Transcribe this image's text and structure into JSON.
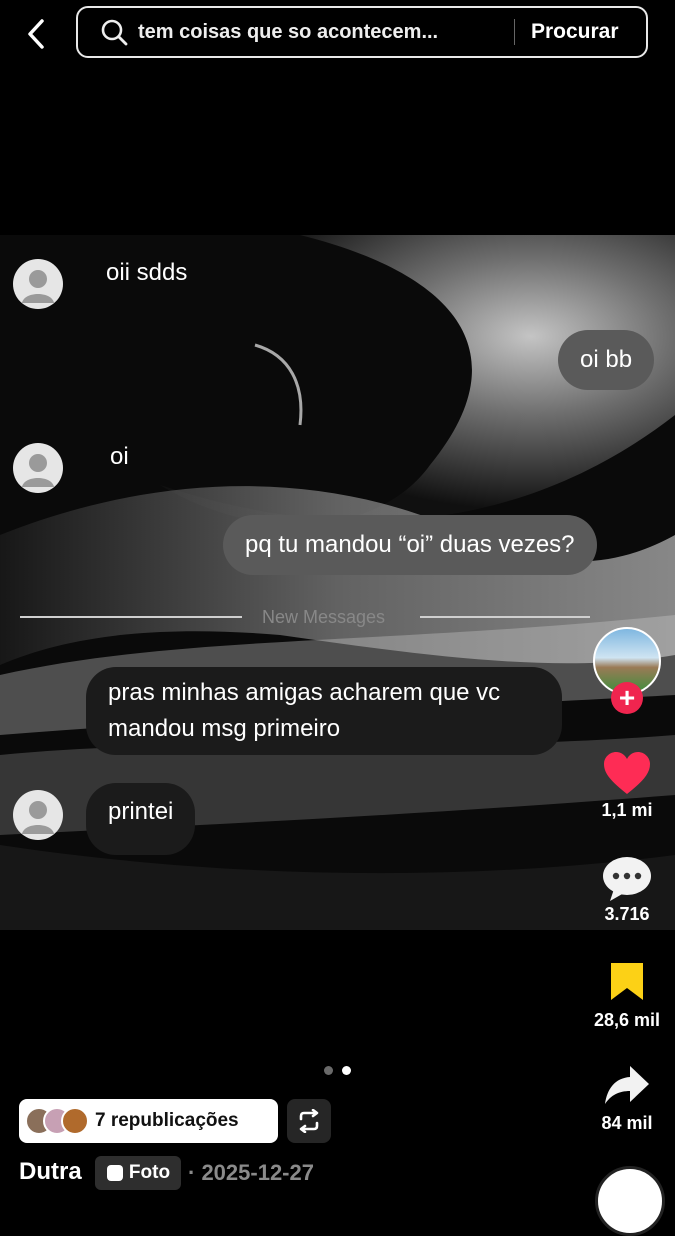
{
  "search": {
    "query": "tem coisas que so acontecem...",
    "button_label": "Procurar"
  },
  "chat": {
    "messages": [
      {
        "side": "in",
        "text": "oii sdds"
      },
      {
        "side": "out",
        "text": "oi bb"
      },
      {
        "side": "in",
        "text": "oi"
      },
      {
        "side": "out",
        "text": "pq tu mandou “oi” duas vezes?"
      },
      {
        "side": "in",
        "text": "pras minhas amigas acharem que vc mandou msg primeiro"
      },
      {
        "side": "in",
        "text": "printei"
      }
    ],
    "divider_label": "New Messages"
  },
  "rail": {
    "likes": "1,1 mi",
    "comments": "3.716",
    "saves": "28,6 mil",
    "shares": "84 mil",
    "like_color": "#fe2c55",
    "save_color": "#fcd116"
  },
  "pager": {
    "count": 2,
    "active": 2
  },
  "post": {
    "republish_label": "7 republicações",
    "author": "Dutra",
    "type_label": "Foto",
    "date": "· 2025-12-27"
  }
}
